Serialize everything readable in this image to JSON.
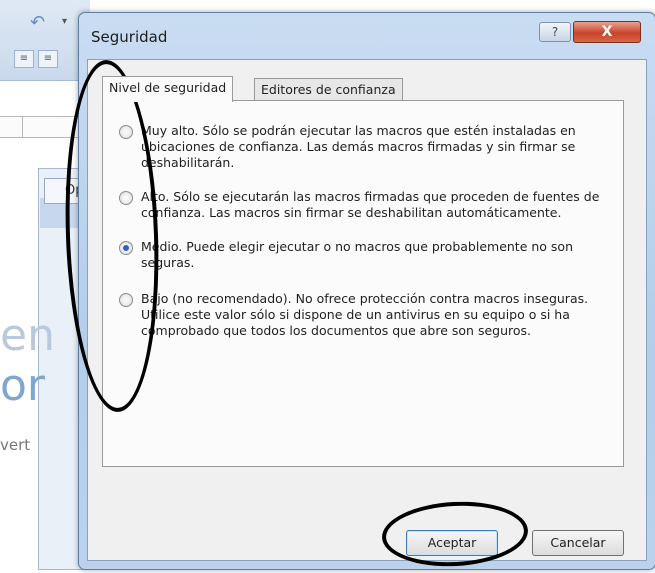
{
  "background_app": {
    "panel_tab_label": "Op",
    "big_text_1": "en",
    "big_text_2": "or",
    "small_text": "vert"
  },
  "dialog": {
    "title": "Seguridad",
    "help_label": "?",
    "close_label": "X",
    "tabs": [
      {
        "label": "Nivel de seguridad",
        "active": true
      },
      {
        "label": "Editores de confianza",
        "active": false
      }
    ],
    "options": [
      {
        "text": "Muy alto. Sólo se podrán ejecutar las macros que estén instaladas en ubicaciones de confianza. Las demás macros firmadas y sin firmar se deshabilitarán.",
        "checked": false
      },
      {
        "text": "Alto. Sólo se ejecutarán las macros firmadas que proceden de fuentes de confianza. Las macros sin firmar se deshabilitan automáticamente.",
        "checked": false
      },
      {
        "text": "Medio. Puede elegir ejecutar o no macros que probablemente no son seguras.",
        "checked": true
      },
      {
        "text": "Bajo (no recomendado). No ofrece protección contra macros inseguras. Utilice este valor sólo si dispone de un antivirus en su equipo o si ha comprobado que todos los documentos que abre son seguros.",
        "checked": false
      }
    ],
    "buttons": {
      "ok_label": "Aceptar",
      "cancel_label": "Cancelar"
    }
  },
  "colors": {
    "title_bar": "#b4cde9",
    "close_button": "#c8452a",
    "radio_selected": "#2a63c4",
    "annotation_ink": "#000000"
  }
}
